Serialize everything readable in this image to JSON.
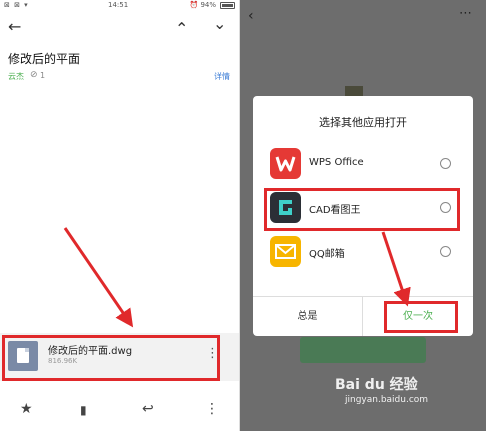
{
  "left": {
    "statusbar": {
      "left_icons": "⊠ ⊠ ▾",
      "time": "14:51",
      "right": "⏰ 94%"
    },
    "mail": {
      "subject": "修改后的平面",
      "sender": "云杰",
      "attach_count": "1",
      "details": "详情"
    },
    "attachment": {
      "name": "修改后的平面.dwg",
      "size": "816.96K"
    },
    "icons": {
      "back": "←",
      "up": "⌃",
      "down": "⌄",
      "more": "⋮",
      "star": "★",
      "trash": "🗑",
      "reply": "↩",
      "paperclip": "🔗"
    }
  },
  "right": {
    "dialog": {
      "title": "选择其他应用打开",
      "apps": [
        {
          "label": "WPS Office",
          "icon_color": "#e53935"
        },
        {
          "label": "CAD看图王",
          "icon_color": "#2b2f36"
        },
        {
          "label": "QQ邮箱",
          "icon_color": "#f7b500"
        }
      ],
      "always": "总是",
      "once": "仅一次"
    },
    "icons": {
      "back": "‹",
      "more": "⋯"
    }
  },
  "watermark": {
    "brand": "Bai du 经验",
    "url": "jingyan.baidu.com"
  },
  "colors": {
    "highlight": "#e0292b",
    "accent_green": "#4caf50",
    "link_blue": "#3a7bd5"
  }
}
